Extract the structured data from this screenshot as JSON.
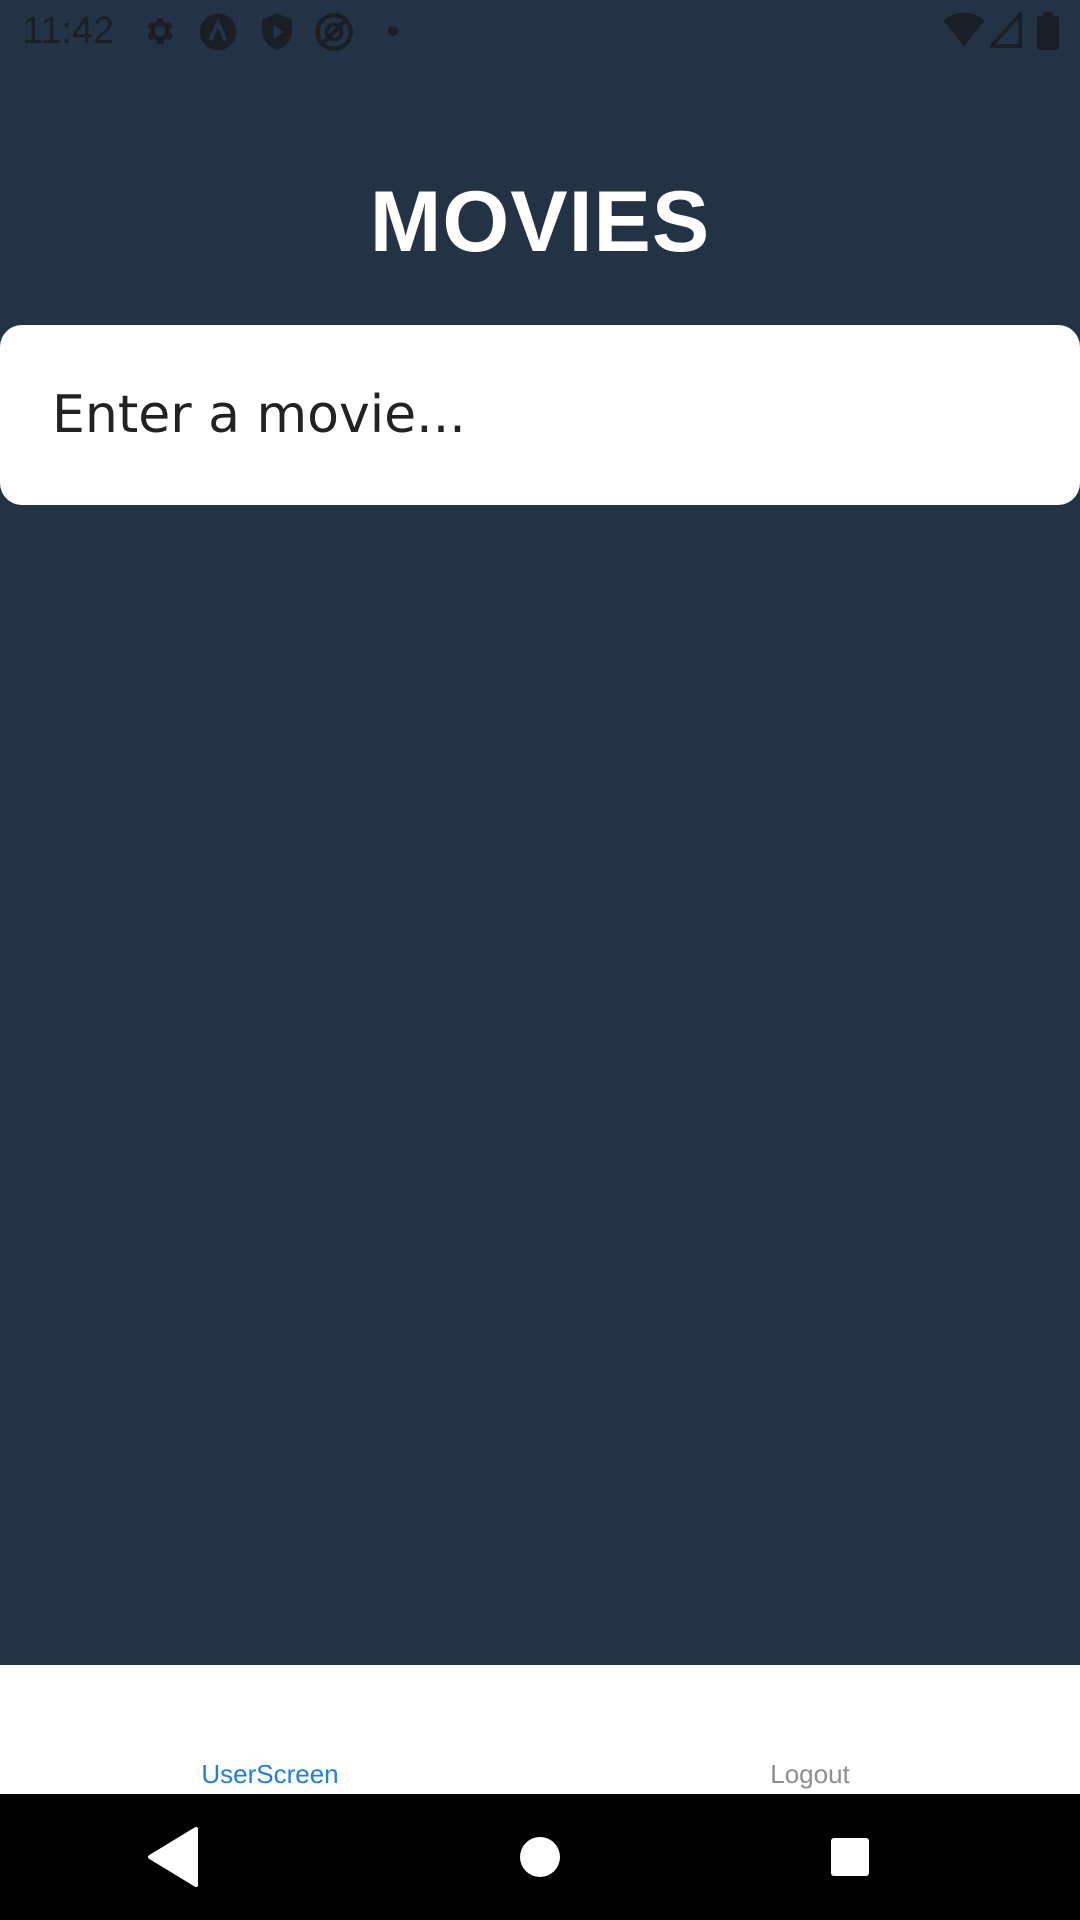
{
  "status_bar": {
    "time": "11:42",
    "icons_left": [
      "gear-icon",
      "vpn-a-icon",
      "shield-play-icon",
      "sync-blocked-icon",
      "dot-icon"
    ],
    "icons_right": [
      "wifi-icon",
      "signal-icon",
      "battery-icon"
    ]
  },
  "header": {
    "title": "MOVIES"
  },
  "search": {
    "placeholder": "Enter a movie...",
    "value": ""
  },
  "tabs": [
    {
      "label": "UserScreen",
      "active": true
    },
    {
      "label": "Logout",
      "active": false
    }
  ],
  "colors": {
    "background": "#233345",
    "active_tab": "#1f7fe0",
    "inactive_tab": "#8e8e93",
    "surface": "#ffffff"
  },
  "nav": {
    "buttons": [
      "back-icon",
      "home-icon",
      "recents-icon"
    ]
  }
}
